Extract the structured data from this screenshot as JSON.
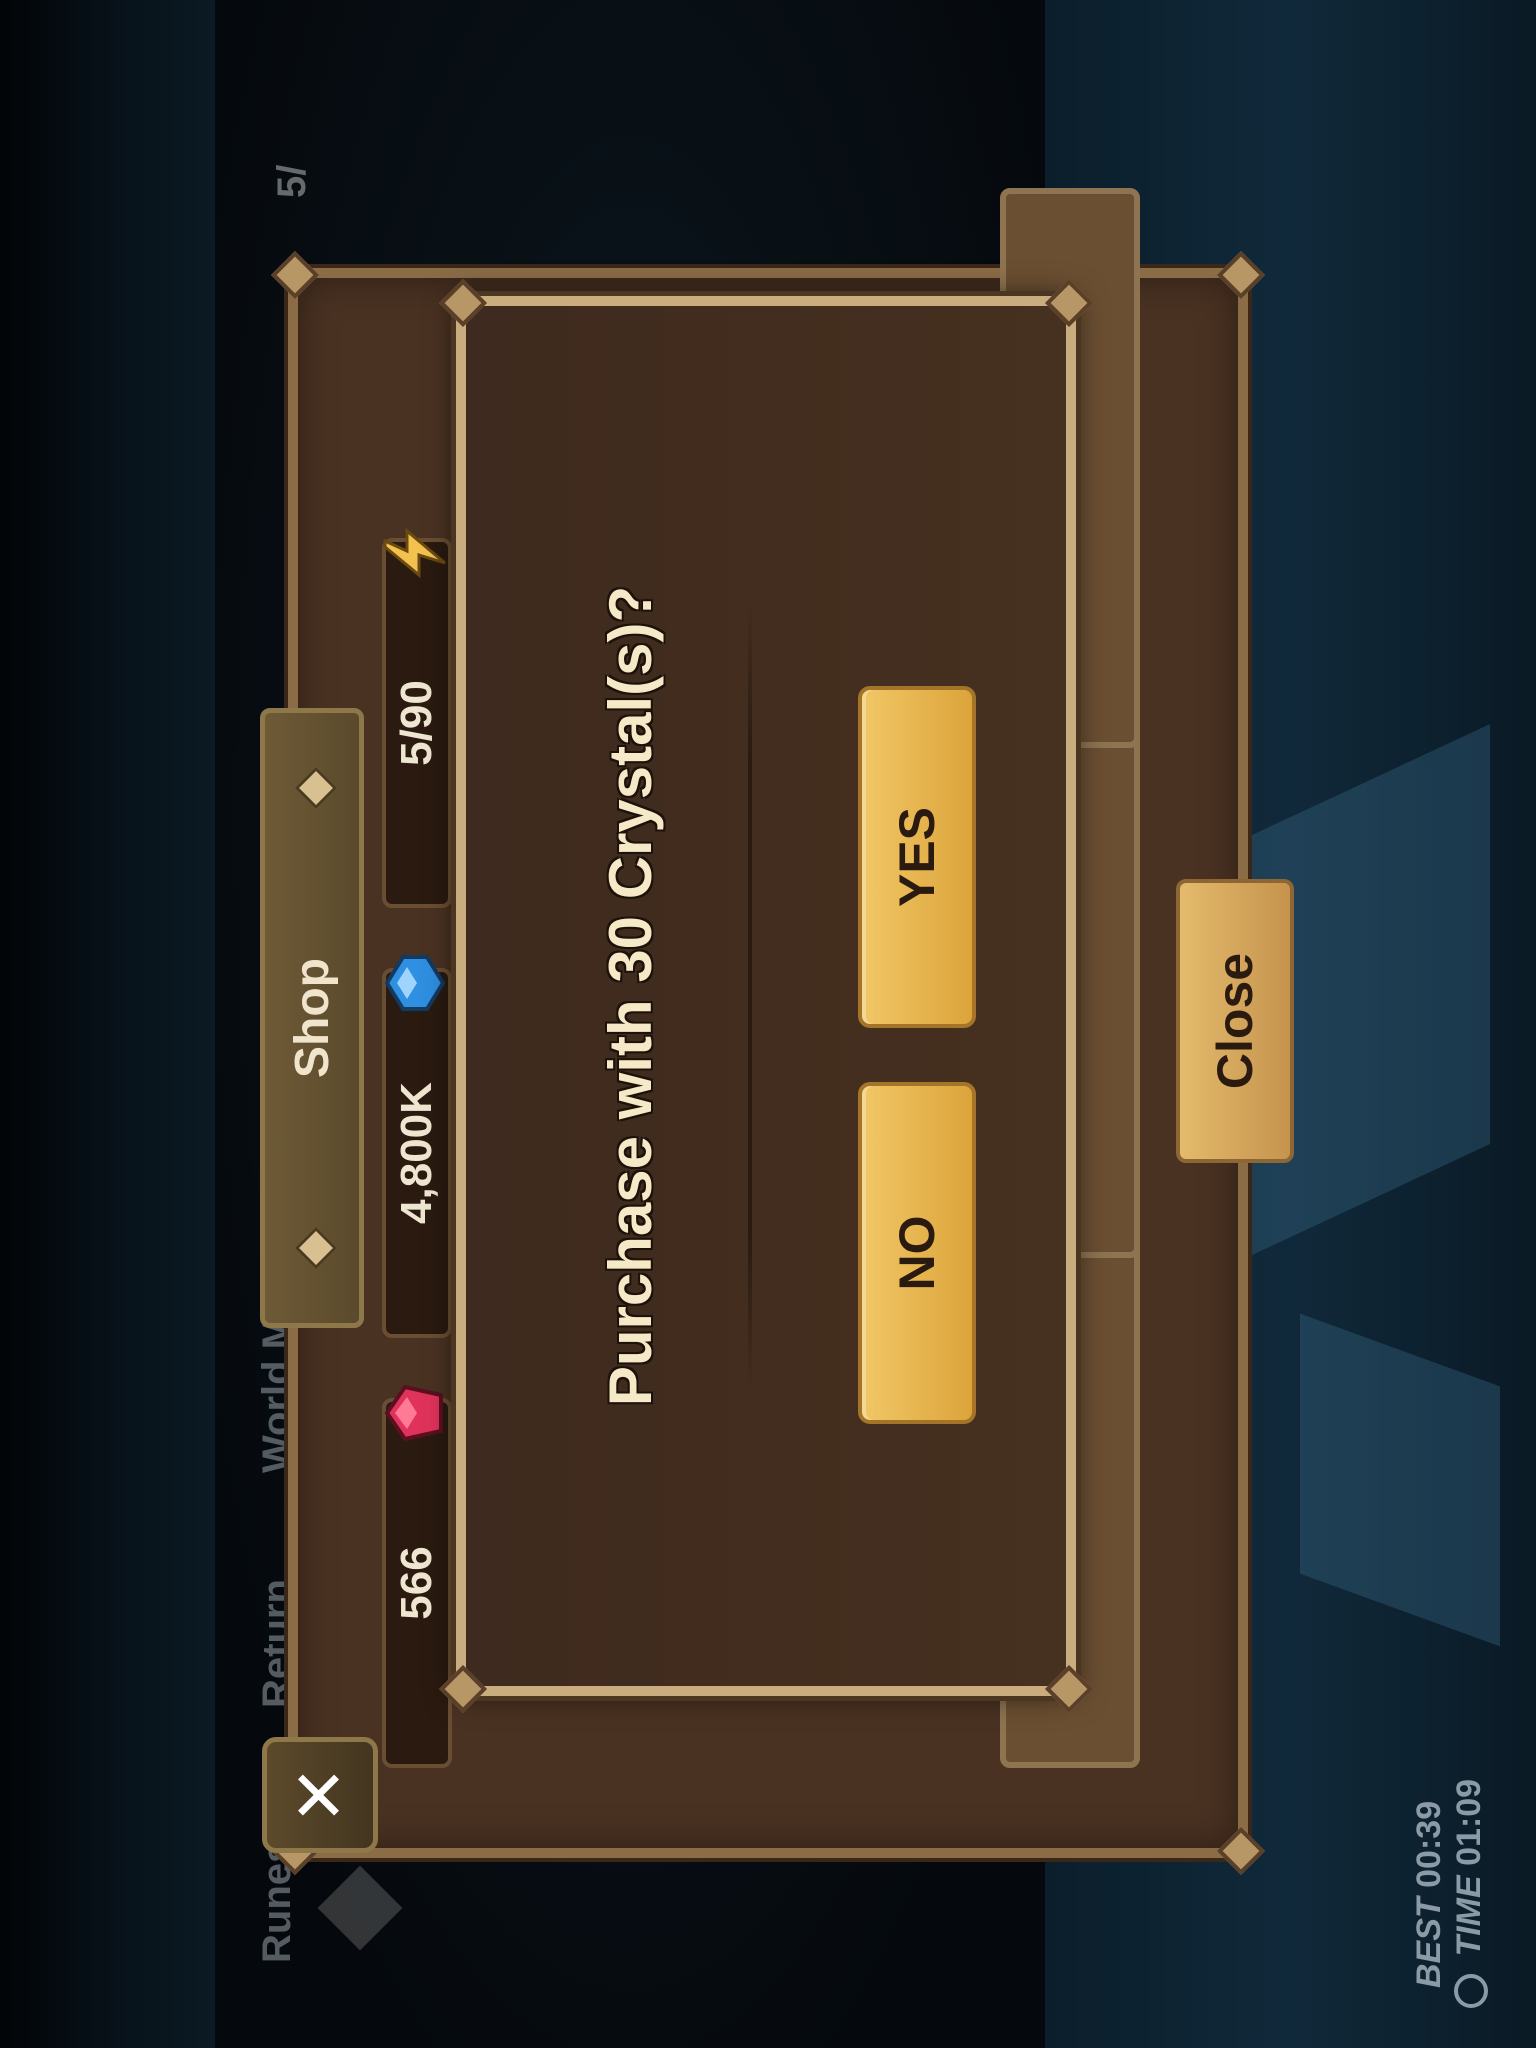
{
  "hud": {
    "time_label": "TIME",
    "time_value": "01:09",
    "best_label": "BEST",
    "best_value": "00:39",
    "energy_partial": "5/"
  },
  "background_menu": {
    "runes": "Runes",
    "return": "Return",
    "world_map": "World Map"
  },
  "shop": {
    "title": "Shop",
    "close_label": "Close",
    "resources": {
      "crystals": "566",
      "mana": "4,800K",
      "energy": "5/90"
    }
  },
  "dialog": {
    "message": "Purchase with 30 Crystal(s)?",
    "no_label": "NO",
    "yes_label": "YES"
  },
  "icons": [
    "close-x-icon",
    "crystal-icon",
    "mana-stone-icon",
    "energy-bolt-icon",
    "clock-icon",
    "runes-icon"
  ],
  "colors": {
    "panel": "#4a3222",
    "dialog": "#3e2a1e",
    "button_gold": "#e6b24e",
    "frame": "#c9ad7e"
  }
}
